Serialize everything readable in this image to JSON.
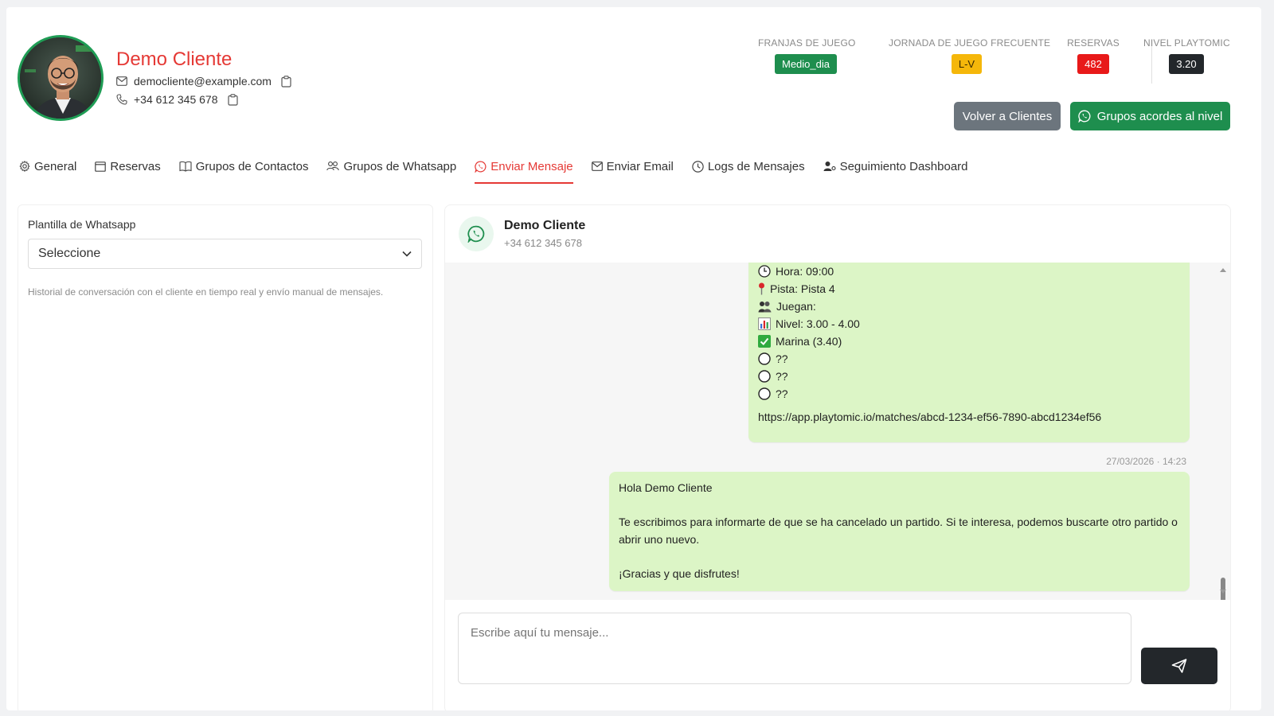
{
  "client": {
    "name": "Demo Cliente",
    "email": "democliente@example.com",
    "phone": "+34 612 345 678"
  },
  "stats": [
    {
      "label": "FRANJAS DE JUEGO",
      "value": "Medio_dia",
      "color": "#1e8e4e",
      "text_color": "#ffffff"
    },
    {
      "label": "JORNADA DE JUEGO FRECUENTE",
      "value": "L-V",
      "color": "#f5b70a",
      "text_color": "#3a2a00"
    },
    {
      "label": "RESERVAS",
      "value": "482",
      "color": "#e81919",
      "text_color": "#ffffff"
    },
    {
      "label": "NIVEL PLAYTOMIC",
      "value": "3.20",
      "color": "#23272b",
      "text_color": "#ffffff"
    }
  ],
  "actions": {
    "back_label": "Volver a Clientes",
    "groups_label": "Grupos acordes al nivel"
  },
  "tabs": [
    {
      "label": "General",
      "icon": "gear-icon"
    },
    {
      "label": "Reservas",
      "icon": "calendar-icon"
    },
    {
      "label": "Grupos de Contactos",
      "icon": "book-icon"
    },
    {
      "label": "Grupos de Whatsapp",
      "icon": "people-icon"
    },
    {
      "label": "Enviar Mensaje",
      "icon": "whatsapp-icon",
      "active": true
    },
    {
      "label": "Enviar Email",
      "icon": "envelope-icon"
    },
    {
      "label": "Logs de Mensajes",
      "icon": "clock-icon"
    },
    {
      "label": "Seguimiento Dashboard",
      "icon": "user-gear-icon"
    }
  ],
  "template_panel": {
    "label": "Plantilla de Whatsapp",
    "selected": "Seleccione",
    "help": "Historial de conversación con el cliente en tiempo real y envío manual de mensajes."
  },
  "chat": {
    "name": "Demo Cliente",
    "phone": "+34 612 345 678",
    "message1": {
      "lines": [
        {
          "emoji": "clock-emoji",
          "text": "Hora: 09:00"
        },
        {
          "emoji": "pin-emoji",
          "text": "Pista: Pista 4"
        },
        {
          "emoji": "players-emoji",
          "text": "Juegan:"
        },
        {
          "emoji": "chart-emoji",
          "text": "Nivel: 3.00 - 4.00"
        },
        {
          "emoji": "check-emoji",
          "text": "Marina (3.40)"
        },
        {
          "emoji": "circle-emoji",
          "text": "??"
        },
        {
          "emoji": "circle-emoji",
          "text": "??"
        },
        {
          "emoji": "circle-emoji",
          "text": "??"
        }
      ],
      "url": "https://app.playtomic.io/matches/abcd-1234-ef56-7890-abcd1234ef56"
    },
    "timestamp": "27/03/2026 · 14:23",
    "message2": {
      "greeting": "Hola Demo Cliente",
      "body": "Te escribimos para informarte de que se ha cancelado un partido. Si te interesa, podemos buscarte otro partido o abrir uno nuevo.",
      "closing": "¡Gracias y que disfrutes!"
    },
    "input_placeholder": "Escribe aquí tu mensaje..."
  },
  "colors": {
    "accent_red": "#e53935",
    "whatsapp_green": "#1e8e4e",
    "bubble_green": "#dcf5c6"
  }
}
